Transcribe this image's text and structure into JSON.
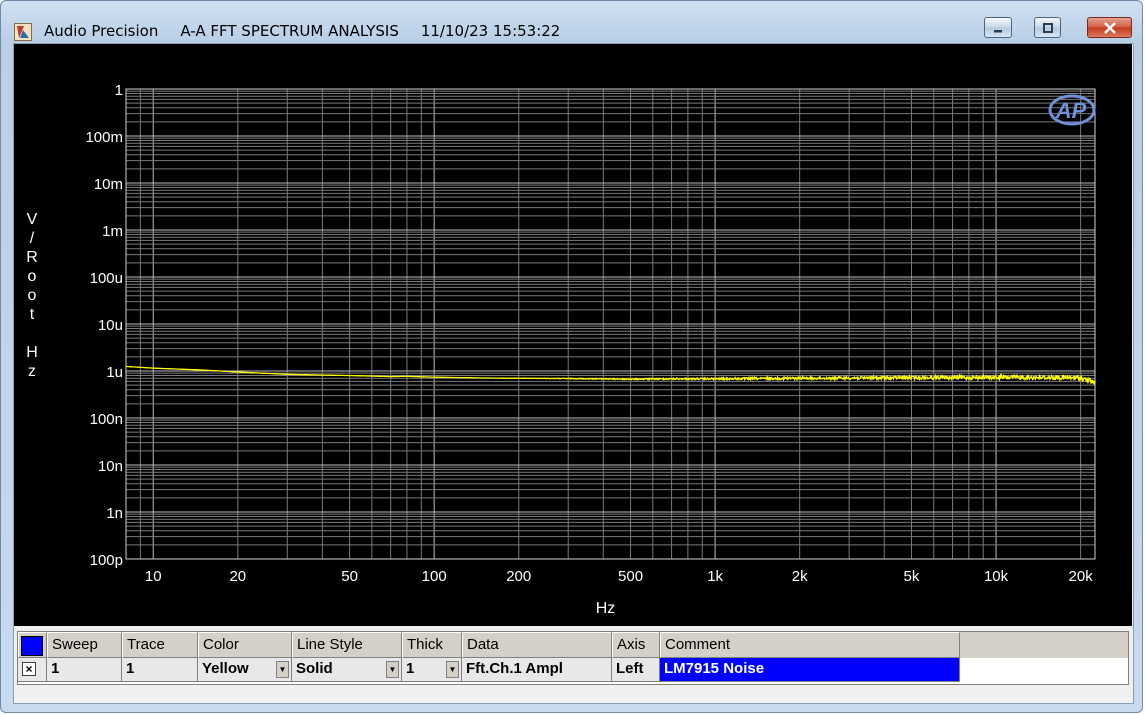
{
  "window": {
    "app_name": "Audio Precision",
    "plot_name": "A-A FFT SPECTRUM ANALYSIS",
    "timestamp": "11/10/23 15:53:22",
    "caption_buttons": [
      "minimize",
      "maximize",
      "close"
    ]
  },
  "chart_data": {
    "type": "line",
    "title": "",
    "xlabel": "Hz",
    "ylabel": "V/Root Hz",
    "x_scale": "log",
    "y_scale": "log",
    "xlim": [
      8,
      22500
    ],
    "ylim": [
      1e-10,
      1
    ],
    "x_ticks": [
      {
        "value": 10,
        "label": "10"
      },
      {
        "value": 20,
        "label": "20"
      },
      {
        "value": 50,
        "label": "50"
      },
      {
        "value": 100,
        "label": "100"
      },
      {
        "value": 200,
        "label": "200"
      },
      {
        "value": 500,
        "label": "500"
      },
      {
        "value": 1000,
        "label": "1k"
      },
      {
        "value": 2000,
        "label": "2k"
      },
      {
        "value": 5000,
        "label": "5k"
      },
      {
        "value": 10000,
        "label": "10k"
      },
      {
        "value": 20000,
        "label": "20k"
      }
    ],
    "y_ticks": [
      {
        "value": 1,
        "label": "1"
      },
      {
        "value": 0.1,
        "label": "100m"
      },
      {
        "value": 0.01,
        "label": "10m"
      },
      {
        "value": 0.001,
        "label": "1m"
      },
      {
        "value": 0.0001,
        "label": "100u"
      },
      {
        "value": 1e-05,
        "label": "10u"
      },
      {
        "value": 1e-06,
        "label": "1u"
      },
      {
        "value": 1e-07,
        "label": "100n"
      },
      {
        "value": 1e-08,
        "label": "10n"
      },
      {
        "value": 1e-09,
        "label": "1n"
      },
      {
        "value": 1e-10,
        "label": "100p"
      }
    ],
    "grid": true,
    "logo": "AP",
    "series": [
      {
        "color": "#ffff00",
        "x": [
          8,
          10,
          15,
          20,
          30,
          40,
          50,
          60,
          70,
          80,
          100,
          150,
          200,
          300,
          500,
          700,
          1000,
          2000,
          3000,
          5000,
          10000,
          15000,
          20000,
          21500,
          22500
        ],
        "y": [
          1.25e-06,
          1.15e-06,
          1.05e-06,
          9.5e-07,
          8.5e-07,
          8.2e-07,
          8e-07,
          7.8e-07,
          7.6e-07,
          7.7e-07,
          7.4e-07,
          7.1e-07,
          7e-07,
          6.9e-07,
          6.7e-07,
          6.8e-07,
          6.8e-07,
          7e-07,
          7.1e-07,
          7.2e-07,
          7.3e-07,
          7.3e-07,
          7.1e-07,
          6.2e-07,
          5.6e-07
        ]
      }
    ]
  },
  "trace_table": {
    "headers": [
      "Sweep",
      "Trace",
      "Color",
      "Line Style",
      "Thick",
      "Data",
      "Axis",
      "Comment"
    ],
    "row": {
      "enabled_mark": "×",
      "sweep": "1",
      "trace": "1",
      "color": "Yellow",
      "line_style": "Solid",
      "thick": "1",
      "data": "Fft.Ch.1 Ampl",
      "axis": "Left",
      "comment": "LM7915 Noise"
    }
  }
}
